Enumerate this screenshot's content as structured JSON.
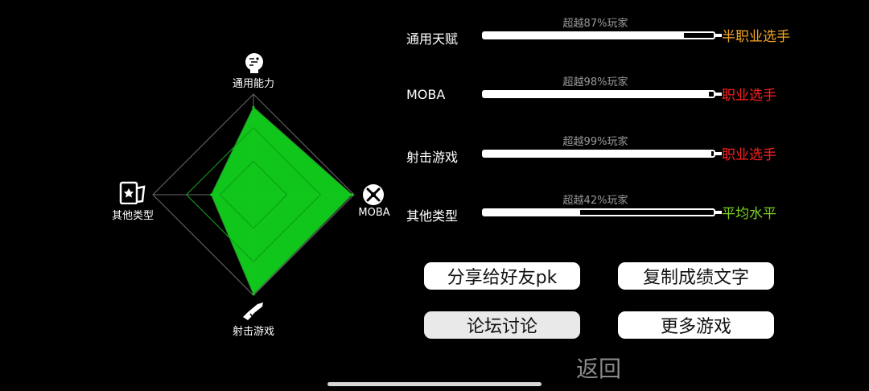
{
  "radar": {
    "axes": [
      {
        "key": "general",
        "label": "通用能力",
        "icon": "head-icon"
      },
      {
        "key": "moba",
        "label": "MOBA",
        "icon": "sword-icon"
      },
      {
        "key": "shooter",
        "label": "射击游戏",
        "icon": "gun-icon"
      },
      {
        "key": "other",
        "label": "其他类型",
        "icon": "card-icon"
      }
    ],
    "values": {
      "general": 0.87,
      "moba": 0.98,
      "shooter": 0.99,
      "other": 0.42
    },
    "fill_color": "#11d11b"
  },
  "stats": [
    {
      "name": "通用天赋",
      "percent_text": "超越87%玩家",
      "fill": 0.87,
      "level": "半职业选手",
      "level_color": "#f5a623"
    },
    {
      "name": "MOBA",
      "percent_text": "超越98%玩家",
      "fill": 0.98,
      "level": "职业选手",
      "level_color": "#ff1f1f"
    },
    {
      "name": "射击游戏",
      "percent_text": "超越99%玩家",
      "fill": 0.99,
      "level": "职业选手",
      "level_color": "#ff1f1f"
    },
    {
      "name": "其他类型",
      "percent_text": "超越42%玩家",
      "fill": 0.42,
      "level": "平均水平",
      "level_color": "#7ed321"
    }
  ],
  "buttons": {
    "share": "分享给好友pk",
    "copy": "复制成绩文字",
    "forum": "论坛讨论",
    "more": "更多游戏"
  },
  "back": "返回"
}
